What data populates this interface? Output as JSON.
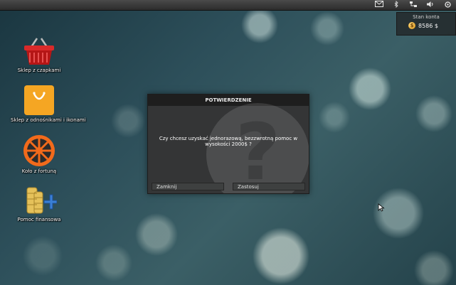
{
  "balance": {
    "title": "Stan konta",
    "value": "8586 $"
  },
  "desktop_icons": [
    {
      "label": "Sklep z czapkami"
    },
    {
      "label": "Sklep z odnośnikami i ikonami"
    },
    {
      "label": "Koło z fortuną"
    },
    {
      "label": "Pomoc finansowa"
    }
  ],
  "dialog": {
    "title": "POTWIERDZENIE",
    "message": "Czy chcesz uzyskać jednorazową, bezzwrotną pomoc w wysokości 2000$ ?",
    "close_label": "Zamknij",
    "apply_label": "Zastosuj"
  },
  "tray_icons": [
    "mail-icon",
    "bluetooth-icon",
    "network-icon",
    "volume-icon",
    "power-icon"
  ],
  "colors": {
    "dialog_bg": "#343536",
    "title_bg": "#1e1e1e",
    "coin": "#e0a020"
  }
}
